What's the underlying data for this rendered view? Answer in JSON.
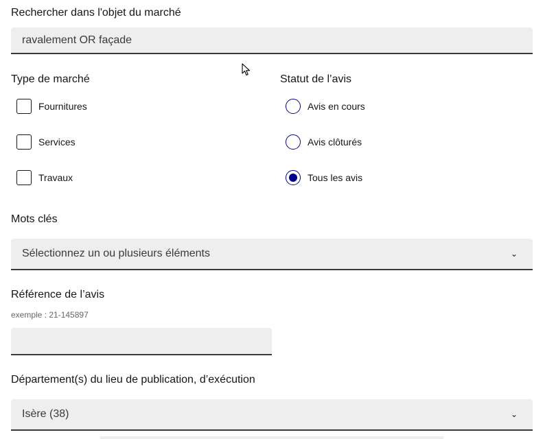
{
  "search": {
    "label": "Rechercher dans l'objet du marché",
    "value": "ravalement OR façade"
  },
  "market_type": {
    "label": "Type de marché",
    "options": [
      "Fournitures",
      "Services",
      "Travaux"
    ]
  },
  "notice_status": {
    "label": "Statut de l’avis",
    "options": [
      "Avis en cours",
      "Avis clôturés",
      "Tous les avis"
    ],
    "selected": "Tous les avis"
  },
  "keywords": {
    "label": "Mots clés",
    "placeholder": "Sélectionnez un ou plusieurs éléments"
  },
  "reference": {
    "label": "Référence de l’avis",
    "hint": "exemple : 21-145897",
    "value": ""
  },
  "department": {
    "label": "Département(s) du lieu de publication, d’exécution",
    "value": "Isère (38)"
  },
  "colors": {
    "accent": "#000091",
    "field_bg": "#eeeeee"
  },
  "icons": {
    "dropdown": "chevron-down-icon",
    "pointer": "mouse-cursor-icon"
  }
}
